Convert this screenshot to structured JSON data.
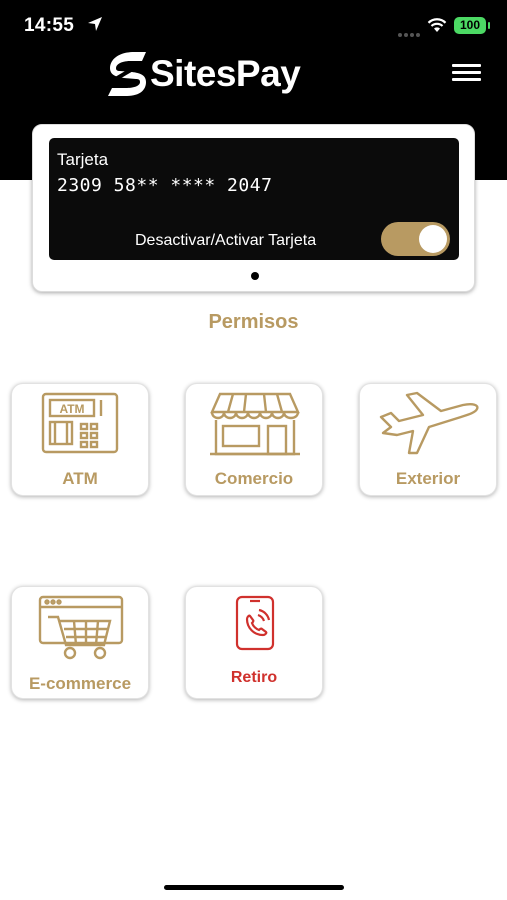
{
  "status_bar": {
    "time": "14:55",
    "battery": "100",
    "icons": [
      "location-arrow-icon",
      "wifi-icon",
      "battery-icon"
    ]
  },
  "header": {
    "brand": "SitesPay",
    "menu_icon": "hamburger-menu-icon"
  },
  "card": {
    "label": "Tarjeta",
    "number": "2309 58** **** 2047",
    "toggle_label": "Desactivar/Activar Tarjeta",
    "toggle_on": true
  },
  "section": {
    "title": "Permisos"
  },
  "permissions": [
    {
      "label": "ATM",
      "icon": "atm-icon",
      "color": "#b89a62"
    },
    {
      "label": "Comercio",
      "icon": "store-icon",
      "color": "#b89a62"
    },
    {
      "label": "Exterior",
      "icon": "airplane-icon",
      "color": "#b89a62"
    },
    {
      "label": "E-commerce",
      "icon": "online-cart-icon",
      "color": "#b89a62"
    },
    {
      "label": "Retiro",
      "icon": "phone-call-icon",
      "color": "#d0312d"
    }
  ],
  "colors": {
    "accent": "#b89a62",
    "alert": "#d0312d",
    "header": "#000000"
  }
}
